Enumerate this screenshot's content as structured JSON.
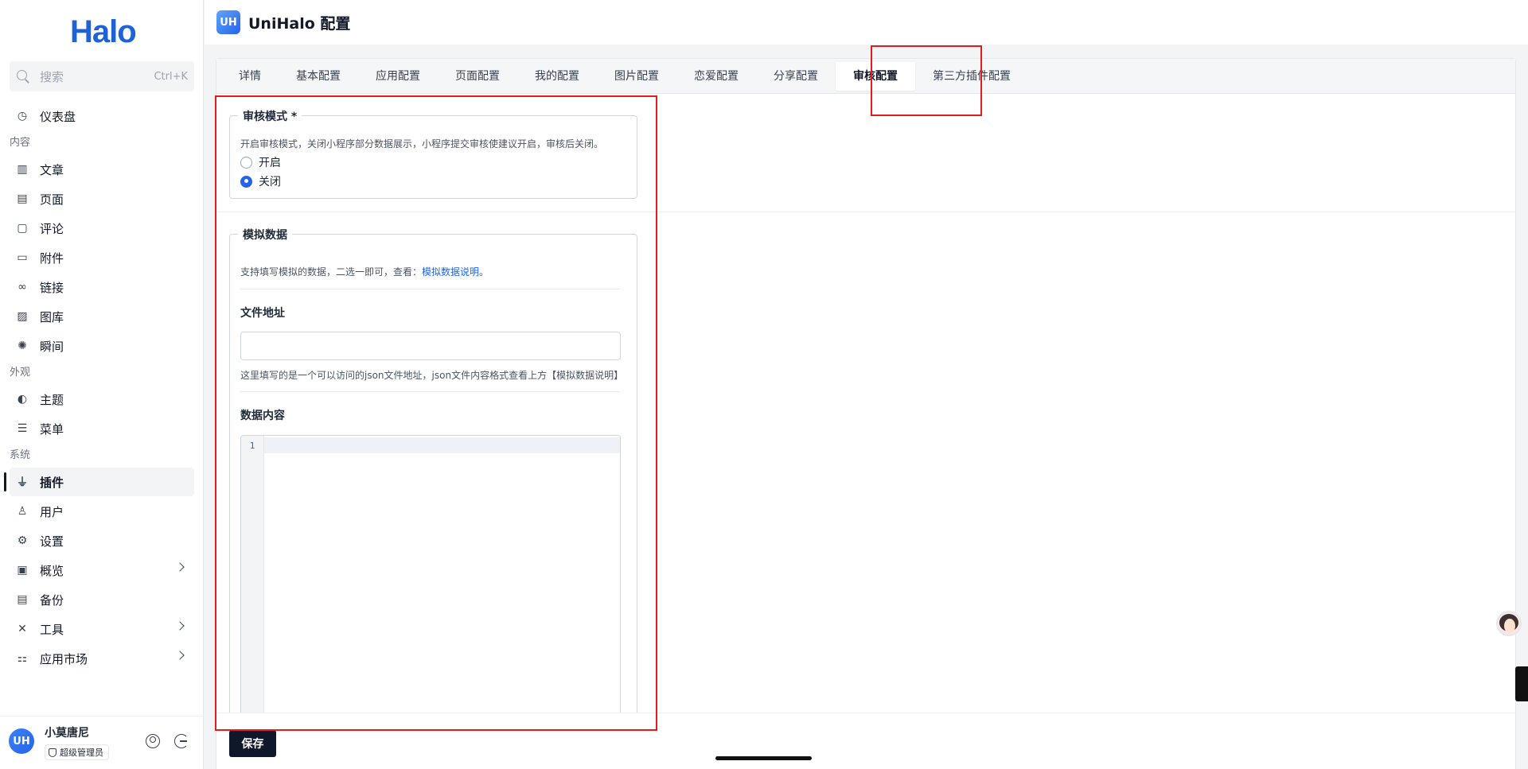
{
  "sidebar": {
    "logo": "Halo",
    "search": {
      "placeholder": "搜索",
      "shortcut": "Ctrl+K"
    },
    "items": [
      {
        "label": "仪表盘",
        "icon": "dashboard-icon"
      },
      {
        "group": "内容"
      },
      {
        "label": "文章",
        "icon": "post-icon"
      },
      {
        "label": "页面",
        "icon": "page-icon"
      },
      {
        "label": "评论",
        "icon": "comment-icon"
      },
      {
        "label": "附件",
        "icon": "folder-icon"
      },
      {
        "label": "链接",
        "icon": "link-icon"
      },
      {
        "label": "图库",
        "icon": "image-icon"
      },
      {
        "label": "瞬间",
        "icon": "moment-icon"
      },
      {
        "group": "外观"
      },
      {
        "label": "主题",
        "icon": "palette-icon"
      },
      {
        "label": "菜单",
        "icon": "menu-icon"
      },
      {
        "group": "系统"
      },
      {
        "label": "插件",
        "icon": "plugin-icon",
        "active": true
      },
      {
        "label": "用户",
        "icon": "user-icon"
      },
      {
        "label": "设置",
        "icon": "gear-icon"
      },
      {
        "label": "概览",
        "icon": "terminal-icon",
        "expandable": true
      },
      {
        "label": "备份",
        "icon": "backup-icon"
      },
      {
        "label": "工具",
        "icon": "tools-icon",
        "expandable": true
      },
      {
        "label": "应用市场",
        "icon": "apps-icon",
        "expandable": true
      }
    ],
    "user": {
      "avatar": "UH",
      "name": "小莫唐尼",
      "role": "超级管理员"
    }
  },
  "header": {
    "logo_text": "UH",
    "title": "UniHalo 配置"
  },
  "tabs": [
    "详情",
    "基本配置",
    "应用配置",
    "页面配置",
    "我的配置",
    "图片配置",
    "恋爱配置",
    "分享配置",
    "审核配置",
    "第三方插件配置"
  ],
  "active_tab": "审核配置",
  "audit": {
    "legend": "审核模式 *",
    "help": "开启审核模式，关闭小程序部分数据展示，小程序提交审核使建议开启，审核后关闭。",
    "options": [
      {
        "label": "开启",
        "checked": false
      },
      {
        "label": "关闭",
        "checked": true
      }
    ]
  },
  "mock": {
    "legend": "模拟数据",
    "help_prefix": "支持填写模拟的数据，二选一即可，查看：",
    "help_link": "模拟数据说明",
    "help_suffix": "。",
    "file_label": "文件地址",
    "file_value": "",
    "file_help": "这里填写的是一个可以访问的json文件地址，json文件内容格式查看上方【模拟数据说明】",
    "content_label": "数据内容",
    "line_number": "1"
  },
  "save_label": "保存",
  "colors": {
    "accent": "#2563eb",
    "annotation": "#e11d1d",
    "save_button": "#0f172a"
  }
}
